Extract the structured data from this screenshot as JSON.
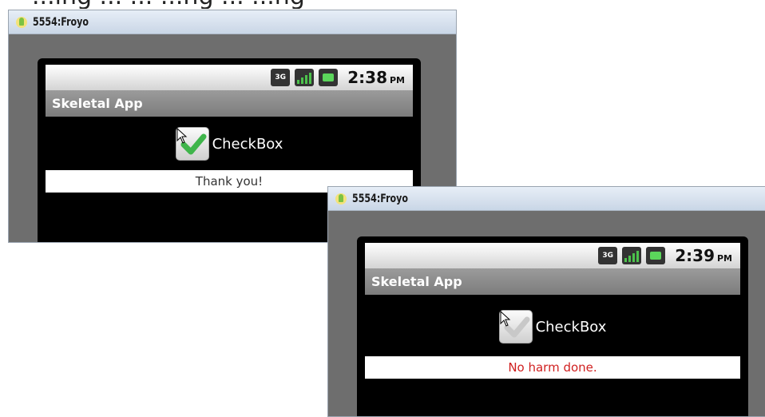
{
  "top_fragment": "...ing ... ... ...ng ... ...ng",
  "windows": [
    {
      "title": "5554:Froyo",
      "status_bar": {
        "network": "3G",
        "time": "2:38",
        "ampm": "PM"
      },
      "app_title": "Skeletal App",
      "checkbox": {
        "label": "CheckBox",
        "checked": true
      },
      "message": "Thank you!",
      "message_color": "#333333"
    },
    {
      "title": "5554:Froyo",
      "status_bar": {
        "network": "3G",
        "time": "2:39",
        "ampm": "PM"
      },
      "app_title": "Skeletal App",
      "checkbox": {
        "label": "CheckBox",
        "checked": false
      },
      "message": "No harm done.",
      "message_color": "#d02020"
    }
  ]
}
